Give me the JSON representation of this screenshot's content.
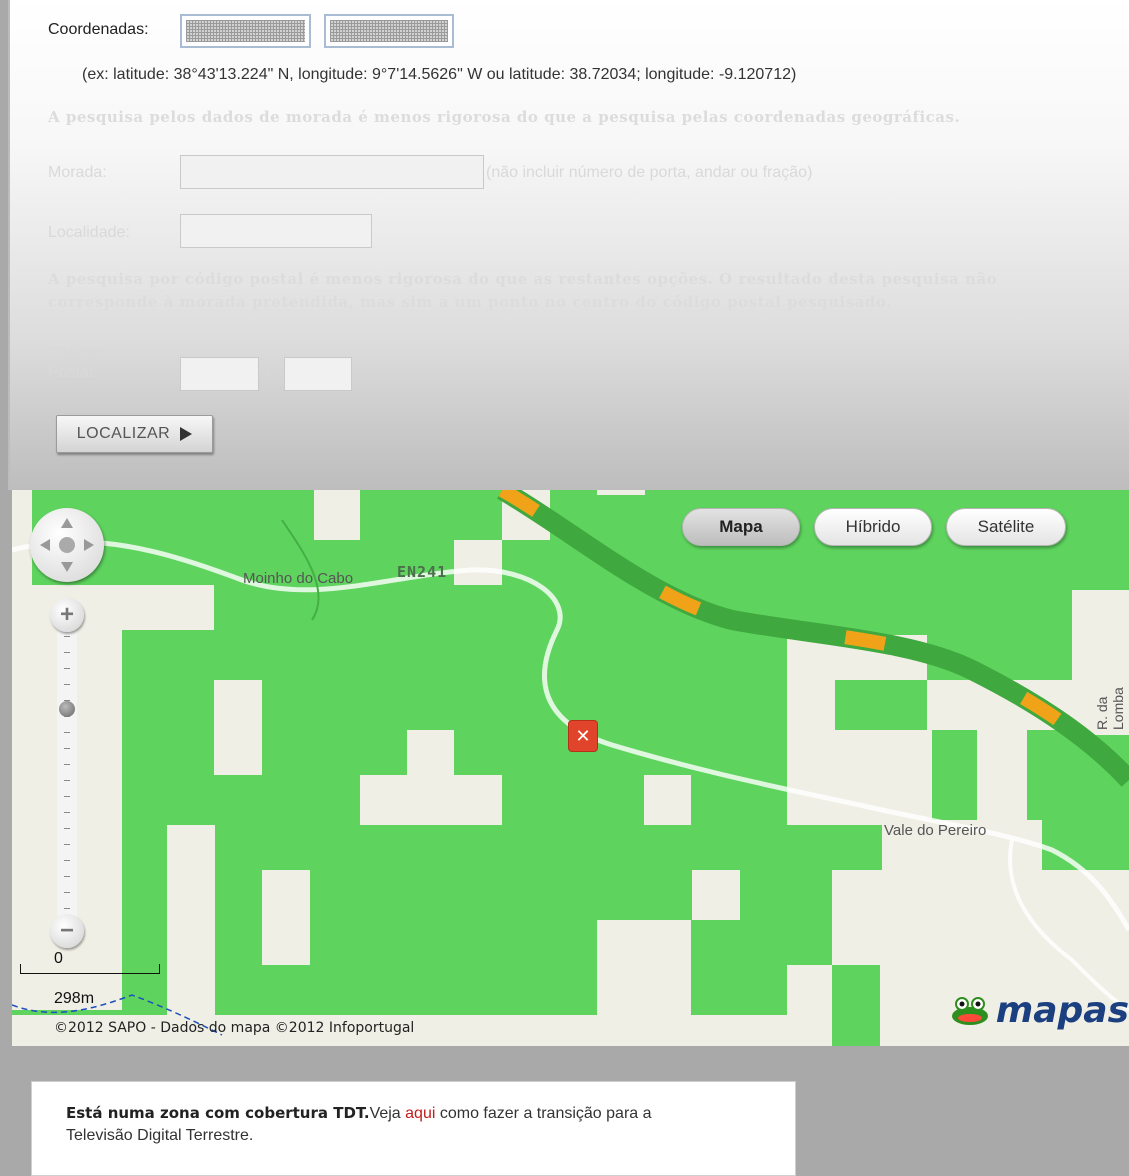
{
  "form": {
    "coords_label": "Coordenadas:",
    "example": "(ex: latitude: 38°43'13.224\" N, longitude: 9°7'14.5626\" W ou latitude: 38.72034; longitude: -9.120712)",
    "address_note": "A pesquisa pelos dados de morada é menos rigorosa do que a pesquisa pelas coordenadas geográficas.",
    "morada_label": "Morada:",
    "morada_hint": "(não incluir número de porta, andar ou fração)",
    "localidade_label": "Localidade:",
    "postal_note_1": "A pesquisa por código postal é menos rigorosa do que as restantes opções. O resultado desta pesquisa não",
    "postal_note_2": "corresponde à morada pretendida, mas sim a um ponto no centro do código postal pesquisado.",
    "postal_label_1": "Código",
    "postal_label_2": "Postal:",
    "postal_sep": "-",
    "locate_button": "LOCALIZAR"
  },
  "map": {
    "types": [
      {
        "label": "Mapa",
        "active": true
      },
      {
        "label": "Híbrido",
        "active": false
      },
      {
        "label": "Satélite",
        "active": false
      }
    ],
    "labels": {
      "moinho": "Moinho do Cabo",
      "road": "EN241",
      "vale": "Vale do Pereiro",
      "rua": "R. da Lomba"
    },
    "scale_zero": "0",
    "scale_distance": "298m",
    "attribution": "©2012 SAPO - Dados do mapa ©2012 Infoportugal",
    "brand": "mapas",
    "zoom_level_fraction": 0.27,
    "colors": {
      "coverage": "#5ed45e",
      "tile": "#f0efe6",
      "highway": "#f0a318",
      "marker": "#e0442a"
    }
  },
  "tdt": {
    "bold": "Está numa zona com cobertura TDT.",
    "text_before_link": "Veja ",
    "link": "aqui",
    "text_after_link": " como fazer a transição para a",
    "line2": "Televisão Digital Terrestre."
  },
  "icons": [
    "pan-icon",
    "zoom-in-icon",
    "zoom-out-icon",
    "marker-icon",
    "frog-logo-icon",
    "play-arrow-icon"
  ]
}
